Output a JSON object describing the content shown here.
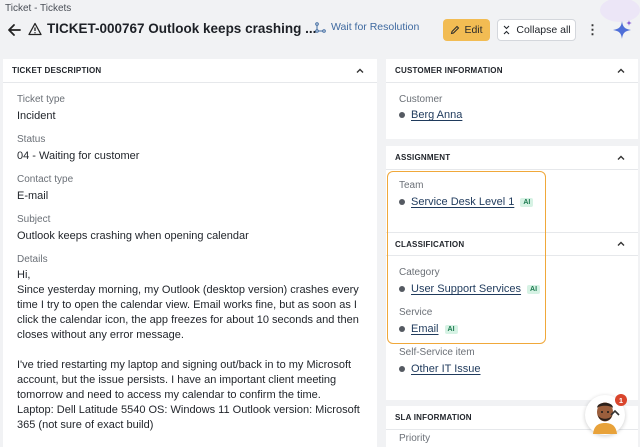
{
  "breadcrumb": "Ticket - Tickets",
  "header": {
    "title": "TICKET-000767 Outlook keeps crashing ...",
    "wait_label": "Wait for Resolution",
    "edit_label": "Edit",
    "collapse_label": "Collapse all",
    "more_label": "⋮"
  },
  "description": {
    "heading": "TICKET DESCRIPTION",
    "fields": [
      {
        "label": "Ticket type",
        "value": "Incident"
      },
      {
        "label": "Status",
        "value": "04 - Waiting for customer"
      },
      {
        "label": "Contact type",
        "value": "E-mail"
      },
      {
        "label": "Subject",
        "value": "Outlook keeps crashing when opening calendar"
      }
    ],
    "details_label": "Details",
    "details_text": "Hi,\nSince yesterday morning, my Outlook (desktop version) crashes every time I try to open the calendar view. Email works fine, but as soon as I click the calendar icon, the app freezes for about 10 seconds and then closes without any error message.\n\nI've tried restarting my laptop and signing out/back in to my Microsoft account, but the issue persists. I have an important client meeting tomorrow and need to access my calendar to confirm the time.\nLaptop: Dell Latitude 5540 OS: Windows 11 Outlook version: Microsoft 365 (not sure of exact build)\n\nCould someone please help ASAP?"
  },
  "customer": {
    "heading": "CUSTOMER INFORMATION",
    "label": "Customer",
    "value": "Berg Anna"
  },
  "assignment": {
    "heading": "ASSIGNMENT",
    "team_label": "Team",
    "team_value": "Service Desk Level 1",
    "ai_label": "AI"
  },
  "classification": {
    "heading": "CLASSIFICATION",
    "category_label": "Category",
    "category_value": "User Support Services",
    "service_label": "Service",
    "service_value": "Email",
    "ai_label": "AI",
    "selfservice_label": "Self-Service item",
    "selfservice_value": "Other IT Issue"
  },
  "sla": {
    "heading": "SLA INFORMATION",
    "priority_label": "Priority"
  },
  "notification_count": "1",
  "colors": {
    "accent": "#f2bc53",
    "highlight_border": "#f0a83a",
    "ai_badge_bg": "#d6f2e4",
    "link": "#1f3a5c"
  }
}
